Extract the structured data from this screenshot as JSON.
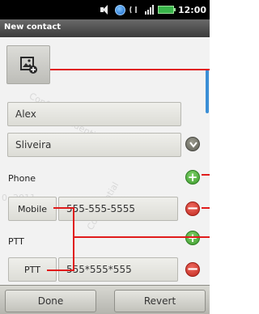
{
  "status_bar": {
    "time": "12:00",
    "icons": [
      "volume-icon",
      "globe-icon",
      "phone-call-icon",
      "signal-icon",
      "battery-icon"
    ],
    "battery_color": "#39b54a"
  },
  "title_bar": {
    "title": "New contact"
  },
  "photo": {
    "icon": "add-photo-icon"
  },
  "name": {
    "first_name": "Alex",
    "last_name": "Sliveira"
  },
  "phone": {
    "section_label": "Phone",
    "type": "Mobile",
    "number": "555-555-5555"
  },
  "ptt": {
    "section_label": "PTT",
    "type": "PTT",
    "number": "555*555*555"
  },
  "buttons": {
    "done": "Done",
    "revert": "Revert"
  },
  "watermark": {
    "text": "Confidential",
    "date": "0, 2011"
  },
  "colors": {
    "annotation": "#e01b1b",
    "add": "#3c9a2c",
    "remove": "#c0271e",
    "scroll": "#3b8fd6"
  }
}
